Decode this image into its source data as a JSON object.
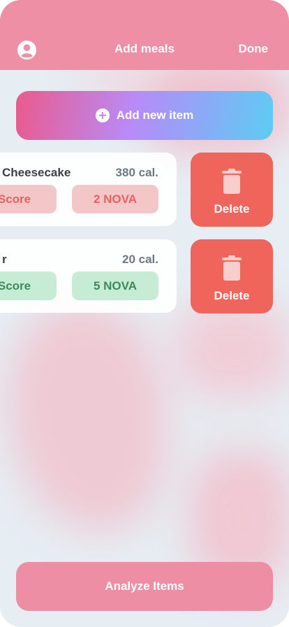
{
  "header": {
    "title": "Add meals",
    "done_label": "Done",
    "avatar_icon": "user-avatar-icon"
  },
  "add_button": {
    "label": "Add new item",
    "icon": "plus-circle-icon"
  },
  "items": [
    {
      "name": "Cheesecake",
      "calories": "380 cal.",
      "score_label": "Score",
      "nova_label": "2 NOVA",
      "tone": "red",
      "delete_label": "Delete"
    },
    {
      "name": "r",
      "calories": "20 cal.",
      "score_label": "Score",
      "nova_label": "5 NOVA",
      "tone": "green",
      "delete_label": "Delete"
    }
  ],
  "analyze_button": {
    "label": "Analyze Items"
  },
  "colors": {
    "header": "#ee8fa5",
    "delete": "#ef655b",
    "analyze": "#ee8ea4",
    "red_pill_text": "#ea5f5f",
    "green_pill_text": "#3e8a5b"
  }
}
